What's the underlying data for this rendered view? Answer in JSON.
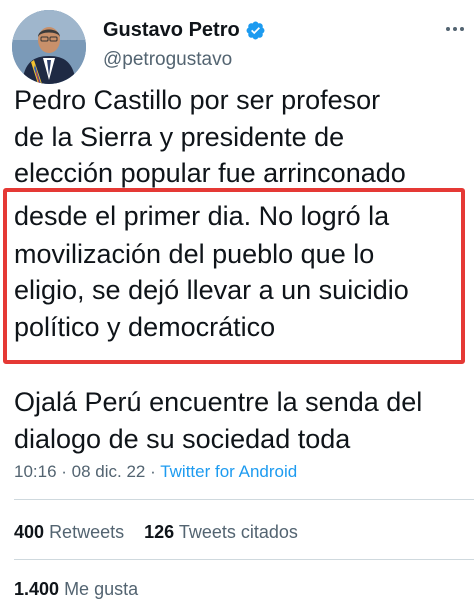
{
  "user": {
    "display_name": "Gustavo Petro",
    "handle": "@petrogustavo",
    "verified": true
  },
  "tweet": {
    "lines": [
      "Pedro Castillo por ser profesor",
      "de la Sierra y presidente de",
      "elección popular fue arrinconado",
      "desde el primer dia. No logró la",
      "movilización del pueblo que lo",
      "eligio, se dejó llevar a un suicidio",
      "político y democrático",
      "Ojalá Perú encuentre la senda del",
      "dialogo de su sociedad toda"
    ]
  },
  "meta": {
    "time": "10:16",
    "separator": " · ",
    "date": "08 dic. 22",
    "source": "Twitter for Android"
  },
  "stats": {
    "retweets_count": "400",
    "retweets_label": "Retweets",
    "quotes_count": "126",
    "quotes_label": "Tweets citados",
    "likes_count": "1.400",
    "likes_label": "Me gusta"
  },
  "colors": {
    "verified": "#1d9bf0",
    "highlight_border": "#e53935",
    "secondary_text": "#536471",
    "link": "#1d9bf0"
  }
}
